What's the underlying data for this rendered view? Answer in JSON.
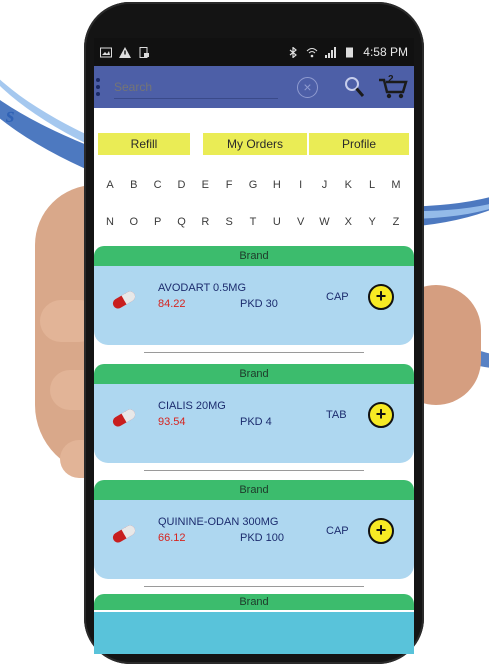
{
  "status_bar": {
    "time": "4:58 PM"
  },
  "search": {
    "placeholder": "Search"
  },
  "cart": {
    "count": "2"
  },
  "nav": {
    "refill": "Refill",
    "my_orders": "My Orders",
    "profile": "Profile"
  },
  "alphabet": {
    "row1": [
      "A",
      "B",
      "C",
      "D",
      "E",
      "F",
      "G",
      "H",
      "I",
      "J",
      "K",
      "L",
      "M"
    ],
    "row2": [
      "N",
      "O",
      "P",
      "Q",
      "R",
      "S",
      "T",
      "U",
      "V",
      "W",
      "X",
      "Y",
      "Z"
    ]
  },
  "products": [
    {
      "section": "Brand",
      "name": "AVODART 0.5MG",
      "price": "84.22",
      "pack": "PKD 30",
      "form": "CAP"
    },
    {
      "section": "Brand",
      "name": "CIALIS 20MG",
      "price": "93.54",
      "pack": "PKD 4",
      "form": "TAB"
    },
    {
      "section": "Brand",
      "name": "QUININE-ODAN 300MG",
      "price": "66.12",
      "pack": "PKD 100",
      "form": "CAP"
    }
  ],
  "partial_section": {
    "label": "Brand"
  },
  "background": {
    "letter": "s"
  },
  "icons": {
    "menu": "overflow-menu-icon",
    "clear": "clear-circle-icon",
    "search": "search-icon",
    "cart": "cart-icon",
    "pill": "pill-capsule-icon",
    "add": "add-circle-icon"
  },
  "colors": {
    "topbar": "#4d5fa7",
    "nav_button": "#eaec55",
    "brand_bar": "#3cbc6d",
    "card": "#aed7f0",
    "price": "#d6241f",
    "add_button": "#f7ea24",
    "bottom_panel": "#59c3da"
  }
}
